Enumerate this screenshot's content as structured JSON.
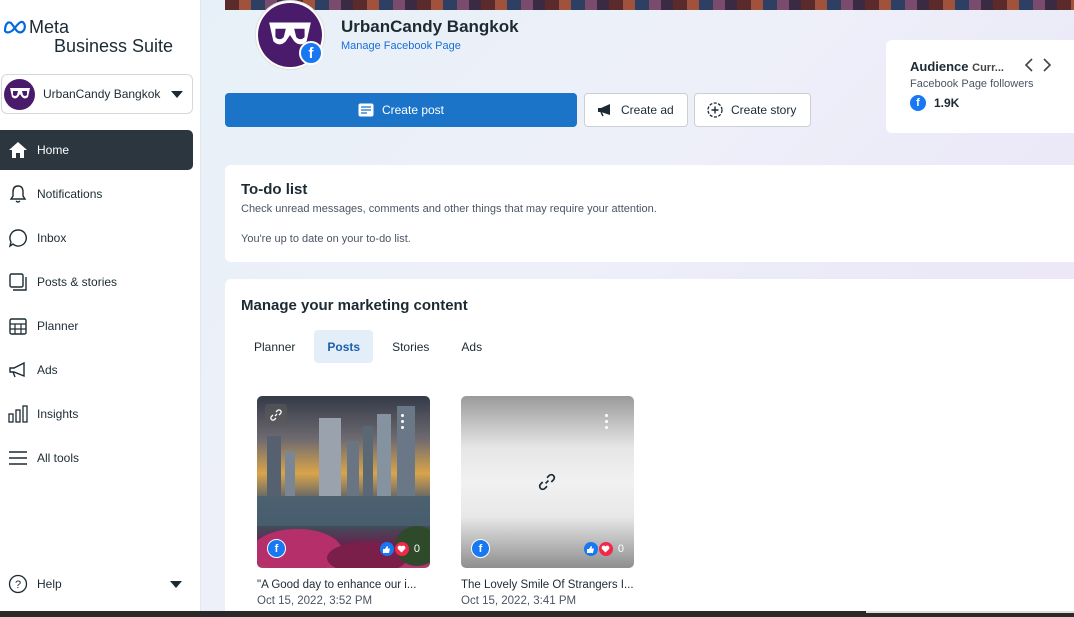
{
  "brand": {
    "line1": "Meta",
    "line2": "Business Suite",
    "color": "#1c2b33"
  },
  "account": {
    "name": "UrbanCandy Bangkok"
  },
  "nav": [
    {
      "label": "Home",
      "icon": "home-icon",
      "active": true
    },
    {
      "label": "Notifications",
      "icon": "bell-icon"
    },
    {
      "label": "Inbox",
      "icon": "chat-bubble-icon"
    },
    {
      "label": "Posts & stories",
      "icon": "posts-icon"
    },
    {
      "label": "Planner",
      "icon": "calendar-icon"
    },
    {
      "label": "Ads",
      "icon": "megaphone-icon"
    },
    {
      "label": "Insights",
      "icon": "bar-chart-icon"
    },
    {
      "label": "All tools",
      "icon": "menu-icon"
    }
  ],
  "help": {
    "label": "Help"
  },
  "page": {
    "title": "UrbanCandy Bangkok",
    "link": "Manage Facebook Page"
  },
  "actions": {
    "create_post": "Create post",
    "create_ad": "Create ad",
    "create_story": "Create story"
  },
  "audience": {
    "title": "Audience",
    "subtitle": "Curr...",
    "label": "Facebook Page followers",
    "value": "1.9K"
  },
  "todo": {
    "title": "To-do list",
    "description": "Check unread messages, comments and other things that may require your attention.",
    "note": "You're up to date on your to-do list."
  },
  "marketing": {
    "title": "Manage your marketing content",
    "tabs": [
      "Planner",
      "Posts",
      "Stories",
      "Ads"
    ],
    "active_tab": "Posts",
    "posts": [
      {
        "caption": "\"A Good day to enhance our i...",
        "date": "Oct 15, 2022, 3:52 PM",
        "reactions": "0"
      },
      {
        "caption": "The Lovely Smile Of Strangers I...",
        "date": "Oct 15, 2022, 3:41 PM",
        "reactions": "0"
      }
    ]
  },
  "colors": {
    "primary": "#1b74c8",
    "facebook": "#1877f2",
    "active_nav": "#2b363e",
    "heart": "#f02849"
  }
}
